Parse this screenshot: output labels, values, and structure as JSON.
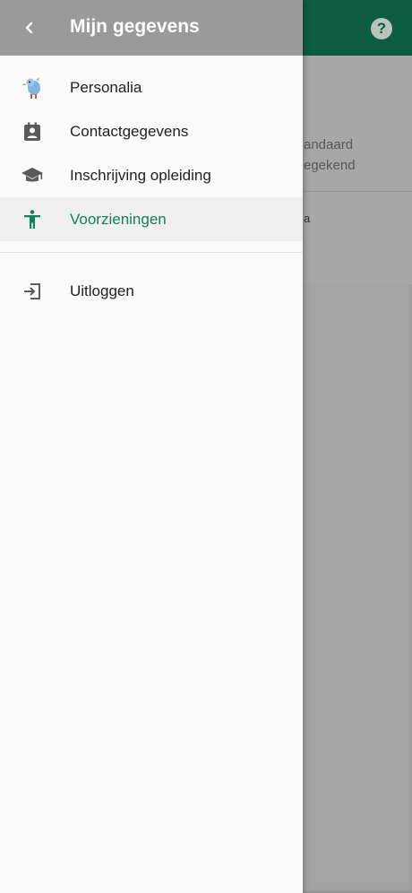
{
  "background": {
    "text_line1": "andaard",
    "text_line2": "egekend",
    "text_line3": "a",
    "help_icon": "help-circle-icon"
  },
  "drawer": {
    "title": "Mijn gegevens",
    "back_icon": "chevron-left-icon",
    "items": [
      {
        "label": "Personalia",
        "icon": "avatar-icon",
        "active": false
      },
      {
        "label": "Contactgegevens",
        "icon": "contact-card-icon",
        "active": false
      },
      {
        "label": "Inschrijving opleiding",
        "icon": "graduation-cap-icon",
        "active": false
      },
      {
        "label": "Voorzieningen",
        "icon": "accessibility-icon",
        "active": true
      }
    ],
    "logout": {
      "label": "Uitloggen",
      "icon": "logout-icon"
    }
  },
  "colors": {
    "header_green": "#0b5c40",
    "accent_green": "#13805a",
    "drawer_header": "#9a9a9a",
    "drawer_bg": "#fafafa",
    "scrim": "#a4a4a4"
  }
}
